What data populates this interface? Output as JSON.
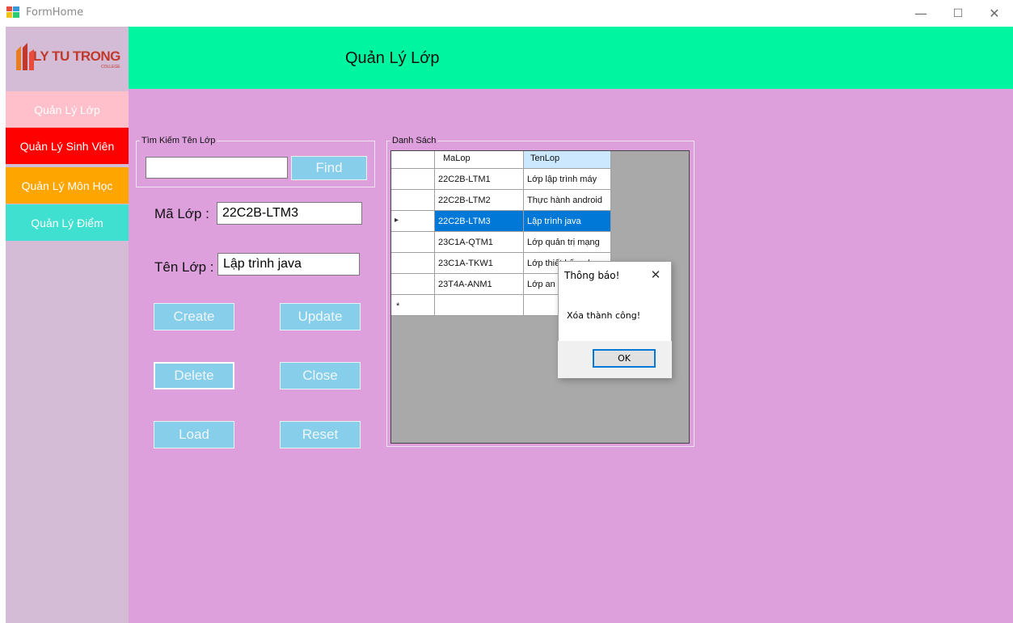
{
  "window": {
    "title": "FormHome",
    "minimize": "—",
    "maximize": "☐",
    "close": "✕"
  },
  "logo": {
    "text": "LY TU TRONG",
    "sub": "COLLEGE",
    "color": "#c0392b"
  },
  "header": {
    "title": "Quản Lý Lớp"
  },
  "sidebar": {
    "items": [
      {
        "label": "Quản Lý Lớp",
        "bg": "#ffc0cb",
        "fg": "#ffffff"
      },
      {
        "label": "Quản Lý Sinh Viên",
        "bg": "#ff0000",
        "fg": "#ffffff"
      },
      {
        "label": "Quản Lý Môn Học",
        "bg": "#ffa500",
        "fg": "#ffffff"
      },
      {
        "label": "Quản Lý Điểm",
        "bg": "#40e0d0",
        "fg": "#ffffff"
      }
    ]
  },
  "search": {
    "legend": "Tìm Kiếm Tên Lớp",
    "value": "",
    "find_label": "Find"
  },
  "form": {
    "ma_lop_label": "Mã Lớp :",
    "ma_lop_value": "22C2B-LTM3",
    "ten_lop_label": "Tên Lớp :",
    "ten_lop_value": "Lập trình java"
  },
  "buttons": {
    "create": "Create",
    "update": "Update",
    "delete": "Delete",
    "close": "Close",
    "load": "Load",
    "reset": "Reset"
  },
  "list": {
    "legend": "Danh Sách",
    "columns": [
      "MaLop",
      "TenLop"
    ],
    "rows": [
      {
        "ma": "22C2B-LTM1",
        "ten": "Lớp lập trình máy"
      },
      {
        "ma": "22C2B-LTM2",
        "ten": "Thực hành android"
      },
      {
        "ma": "22C2B-LTM3",
        "ten": "Lập trình java"
      },
      {
        "ma": "23C1A-QTM1",
        "ten": "Lớp quản trị mạng"
      },
      {
        "ma": "23C1A-TKW1",
        "ten": "Lớp thiết kế web"
      },
      {
        "ma": "23T4A-ANM1",
        "ten": "Lớp an ninh mạng"
      }
    ],
    "selected_marker": "▸",
    "new_row_marker": "*"
  },
  "dialog": {
    "title": "Thông báo!",
    "close": "✕",
    "message": "Xóa thành công!",
    "ok": "OK"
  }
}
